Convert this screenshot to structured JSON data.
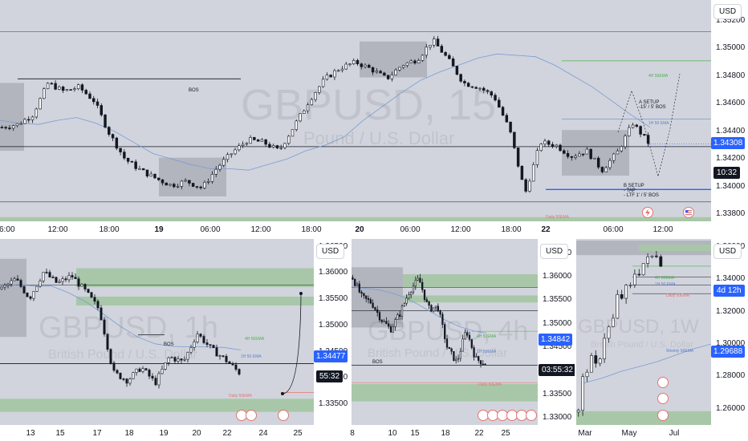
{
  "chart_data": [
    {
      "type": "candlestick",
      "symbol": "GBPUSD",
      "interval": "15",
      "watermark": "GBPUSD, 15",
      "subtitle": "Pound / U.S. Dollar",
      "currency": "USD",
      "y_ticks": [
        "1.35200",
        "1.35000",
        "1.34800",
        "1.34600",
        "1.34400",
        "1.34200",
        "1.34000",
        "1.33800"
      ],
      "ylim": [
        1.3375,
        1.3535
      ],
      "x_ticks": [
        "06:00",
        "12:00",
        "18:00",
        "19",
        "06:00",
        "12:00",
        "18:00",
        "20",
        "06:00",
        "12:00",
        "18:00",
        "22",
        "06:00",
        "12:00"
      ],
      "bold_ticks": [
        "19",
        "20",
        "22"
      ],
      "last_price": "1.34308",
      "countdown": "10:32",
      "close_path": [
        1.3443,
        1.3445,
        1.3452,
        1.3475,
        1.3469,
        1.3472,
        1.3462,
        1.3438,
        1.342,
        1.3412,
        1.3406,
        1.3401,
        1.3404,
        1.3399,
        1.3414,
        1.3425,
        1.3434,
        1.3432,
        1.3426,
        1.3444,
        1.3463,
        1.3478,
        1.3486,
        1.349,
        1.3485,
        1.3478,
        1.3488,
        1.3492,
        1.3506,
        1.3492,
        1.3475,
        1.3472,
        1.3465,
        1.3441,
        1.3395,
        1.3432,
        1.343,
        1.3422,
        1.3426,
        1.3412,
        1.3425,
        1.3446,
        1.3432
      ],
      "ema_path": [
        1.3448,
        1.3446,
        1.3445,
        1.3448,
        1.345,
        1.3446,
        1.344,
        1.3432,
        1.3424,
        1.342,
        1.3416,
        1.3413,
        1.3413,
        1.3412,
        1.3416,
        1.342,
        1.3426,
        1.343,
        1.3436,
        1.3448,
        1.3458,
        1.3468,
        1.3477,
        1.3483,
        1.3488,
        1.3493,
        1.3496,
        1.3495,
        1.3494,
        1.3488,
        1.348,
        1.3472,
        1.3462,
        1.3452,
        1.3443
      ],
      "levels": {
        "top_zone": [
          1.3535,
          1.3552
        ],
        "bos_high": 1.3478,
        "horizontal": 1.3429,
        "lower_line": 1.3389,
        "bottom_zone": [
          1.3368,
          1.3378
        ],
        "blue_line": 1.3398,
        "ema_4h": 1.3491,
        "ema_1h": 1.3449
      },
      "annotations": [
        "BOS",
        "A SETUP",
        "-15' / 5' BOS",
        "B SETUP",
        "- TAP",
        "- LTF 1' / 5' BOS",
        "4H 50EMA",
        "1H 50 EMA",
        "Daily 50EMA"
      ]
    },
    {
      "type": "candlestick",
      "symbol": "GBPUSD",
      "interval": "1h",
      "watermark": "GBPUSD, 1h",
      "subtitle": "British Pound / U.S. Dollar",
      "currency": "USD",
      "y_ticks": [
        "1.36500",
        "1.36000",
        "1.35500",
        "1.35000",
        "1.34500",
        "1.34000",
        "1.33500"
      ],
      "ylim": [
        1.331,
        1.3665
      ],
      "x_ticks": [
        "13",
        "15",
        "17",
        "18",
        "19",
        "20",
        "22",
        "24",
        "25"
      ],
      "last_price": "1.34477",
      "countdown": "55:32",
      "close_path": [
        1.357,
        1.3588,
        1.3552,
        1.3602,
        1.358,
        1.3595,
        1.3565,
        1.353,
        1.341,
        1.3395,
        1.342,
        1.339,
        1.344,
        1.343,
        1.3485,
        1.3455,
        1.3435,
        1.341
      ],
      "ema_path": [
        1.3572,
        1.3578,
        1.3575,
        1.3575,
        1.3562,
        1.3545,
        1.3522,
        1.3498,
        1.3478,
        1.3465,
        1.346,
        1.3459,
        1.3459,
        1.3458,
        1.3453
      ],
      "annotations": [
        "BOS",
        "4H 50EMA",
        "1H 50 EMA",
        "Daily 50EMA"
      ]
    },
    {
      "type": "candlestick",
      "symbol": "GBPUSD",
      "interval": "4h",
      "watermark": "GBPUSD, 4h",
      "subtitle": "British Pound / U.S. Dollar",
      "currency": "USD",
      "y_ticks": [
        "1.36500",
        "1.36000",
        "1.35500",
        "1.35000",
        "1.34500",
        "1.33500",
        "1.33000"
      ],
      "ylim": [
        1.3285,
        1.368
      ],
      "x_ticks": [
        "8",
        "10",
        "15",
        "18",
        "22",
        "25"
      ],
      "last_price": "1.34842",
      "countdown": "03:55:32",
      "close_path": [
        1.3598,
        1.3555,
        1.3545,
        1.351,
        1.3488,
        1.3522,
        1.357,
        1.3595,
        1.3532,
        1.3535,
        1.3448,
        1.3418,
        1.3487,
        1.3425,
        1.3416
      ],
      "ema_path": [
        1.3578,
        1.3575,
        1.3572,
        1.3565,
        1.3555,
        1.354,
        1.3523,
        1.3507,
        1.3494,
        1.3485,
        1.348
      ],
      "annotations": [
        "BOS",
        "4H 50EMA",
        "1H 50EMA",
        "Daily 50EMA"
      ]
    },
    {
      "type": "candlestick",
      "symbol": "GBPUSD",
      "interval": "1W",
      "watermark": "GBPUSD, 1W",
      "subtitle": "British Pound / U.S. Dollar",
      "currency": "USD",
      "y_ticks": [
        "1.36000",
        "1.34000",
        "1.32000",
        "1.30000",
        "1.28000",
        "1.26000"
      ],
      "ylim": [
        1.25,
        1.365
      ],
      "x_ticks": [
        "Mar",
        "May",
        "Jul"
      ],
      "last_price": "1.29688",
      "countdown": "4d 12h",
      "close_path": [
        1.258,
        1.278,
        1.285,
        1.29,
        1.286,
        1.293,
        1.305,
        1.31,
        1.315,
        1.329,
        1.329,
        1.334,
        1.335,
        1.344,
        1.345,
        1.35,
        1.352,
        1.354,
        1.356,
        1.351
      ],
      "ema_path": [
        1.276,
        1.279,
        1.283,
        1.286,
        1.289,
        1.293,
        1.297,
        1.3
      ],
      "annotations": [
        "4H 50EMA",
        "1H 50 EMA",
        "Daily 50EMA",
        "Weekly 50EMA"
      ]
    }
  ],
  "icons": [
    "flash-event-icon",
    "us-flag-event-icon"
  ],
  "colors": {
    "panel_bg": "#d1d4dc",
    "up": "#ffffff",
    "down": "#131722",
    "price_label": "#2962ff",
    "ema_1h": "#7b9bd6",
    "ema_4h": "#4caf50",
    "ema_daily": "#e57373",
    "zone_green": "#a8c7a8",
    "zone_grey": "#b2b5be"
  }
}
